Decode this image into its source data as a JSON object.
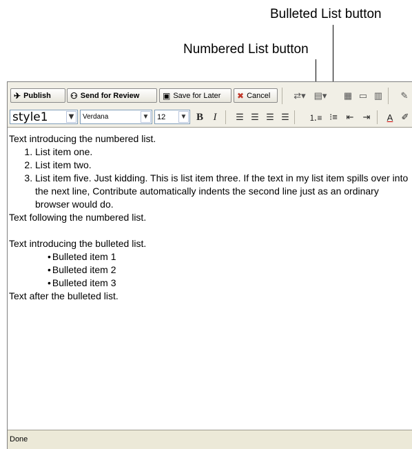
{
  "callouts": {
    "bulleted": "Bulleted List button",
    "numbered": "Numbered List button"
  },
  "toolbar": {
    "publish": "Publish",
    "send_for_review": "Send for Review",
    "save_for_later": "Save for Later",
    "cancel": "Cancel"
  },
  "format": {
    "style": "style1",
    "font": "Verdana",
    "size": "12",
    "bold": "B",
    "italic": "I",
    "text_color": "A"
  },
  "content": {
    "intro_numbered": "Text introducing the numbered list.",
    "numbered_items": [
      "List item one.",
      "List item two.",
      "List item five. Just kidding. This is list item three. If the text in my list item spills over into the next line, Contribute automatically indents the second line just as an ordinary browser would do."
    ],
    "after_numbered": "Text following the numbered list.",
    "intro_bulleted": "Text introducing the bulleted list.",
    "bulleted_items": [
      "Bulleted item 1",
      "Bulleted item 2",
      "Bulleted item 3"
    ],
    "after_bulleted": "Text after the bulleted list."
  },
  "status": "Done"
}
